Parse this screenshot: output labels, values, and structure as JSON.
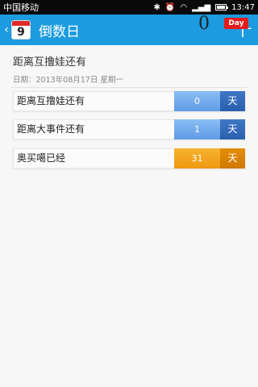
{
  "status_bar": {
    "carrier": "中国移动",
    "time": "13:47",
    "bluetooth_icon": "bluetooth-icon",
    "alarm_icon": "alarm-icon",
    "wifi_icon": "wifi-icon",
    "signal_icon": "signal-icon",
    "battery_icon": "battery-icon"
  },
  "header": {
    "back_icon": "back-arrow-icon",
    "calendar_day": "9",
    "title": "倒数日",
    "add_icon": "plus-icon",
    "color": "#1c9be0"
  },
  "hero": {
    "title": "距离互撸娃还有",
    "date": "日期：2013年08月17日 星期一",
    "count": "0",
    "badge": "Day"
  },
  "items": [
    {
      "label": "距离互撸娃还有",
      "value": "0",
      "unit": "天",
      "color": "blue"
    },
    {
      "label": "距离大事件还有",
      "value": "1",
      "unit": "天",
      "color": "blue"
    },
    {
      "label": "奥买噶已经",
      "value": "31",
      "unit": "天",
      "color": "orange"
    }
  ]
}
